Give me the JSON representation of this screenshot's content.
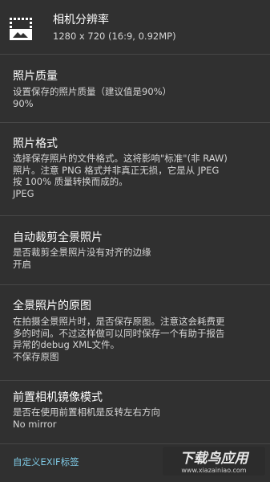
{
  "resolution": {
    "title": "相机分辨率",
    "summary": "1280 x 720 (16:9, 0.92MP)",
    "icon": "photo-size-select-icon"
  },
  "photo_quality": {
    "title": "照片质量",
    "summary": "设置保存的照片质量（建议值是90%）",
    "value": "90%"
  },
  "photo_format": {
    "title": "照片格式",
    "summary": "选择保存照片的文件格式。这将影响\"标准\"(非 RAW)\n照片。注意 PNG 格式并非真正无损，它是从 JPEG\n按 100% 质量转换而成的。",
    "value": "JPEG"
  },
  "auto_crop_panorama": {
    "title": "自动裁剪全景照片",
    "summary": "是否裁剪全景照片没有对齐的边缘",
    "value": "开启"
  },
  "panorama_original": {
    "title": "全景照片的原图",
    "summary": "在拍摄全景照片时，是否保存原图。注意这会耗费更\n多的时间。不过这样做可以同时保存一个有助于报告\n异常的debug XML文件。",
    "value": "不保存原图"
  },
  "front_camera_mirror": {
    "title": "前置相机镜像模式",
    "summary": "是否在使用前置相机是反转左右方向",
    "value": "No mirror"
  },
  "custom_exif": {
    "label": "自定义EXIF标签"
  },
  "watermark": {
    "main": "下载鸟应用",
    "sub": "www.xiazainiao.com"
  },
  "colors": {
    "background": "#303030",
    "divider": "#474747",
    "link": "#7ec8e3"
  }
}
